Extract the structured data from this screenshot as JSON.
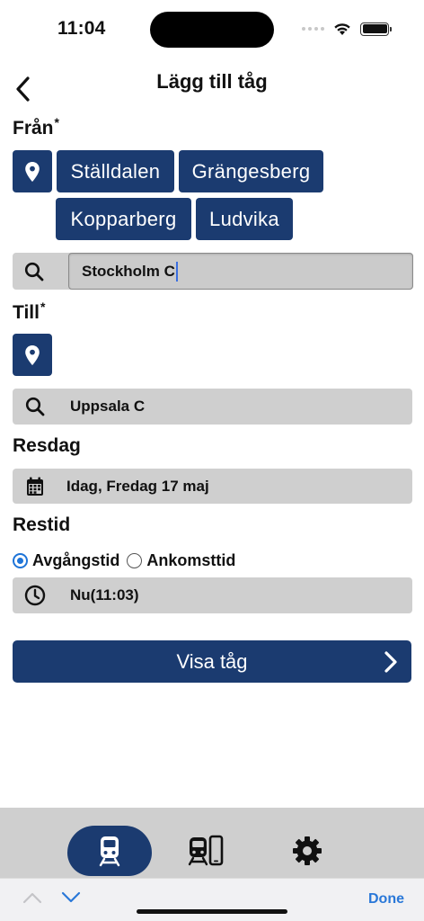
{
  "status_bar": {
    "time": "11:04"
  },
  "header": {
    "title": "Lägg till tåg"
  },
  "from": {
    "label": "Från",
    "required_mark": "*",
    "chips": [
      "Ställdalen",
      "Grängesberg",
      "Kopparberg",
      "Ludvika"
    ],
    "search_value": "Stockholm C"
  },
  "to": {
    "label": "Till",
    "required_mark": "*",
    "search_value": "Uppsala C"
  },
  "travel_day": {
    "label": "Resdag",
    "value": "Idag, Fredag 17 maj"
  },
  "travel_time": {
    "label": "Restid",
    "options": [
      "Avgångstid",
      "Ankomsttid"
    ],
    "selected": "Avgångstid",
    "value": "Nu(11:03)"
  },
  "submit": {
    "label": "Visa tåg"
  },
  "tabbar": {
    "items": [
      "train-icon",
      "train-phone-icon",
      "settings-gear-icon"
    ],
    "active": 0
  },
  "keyboard_accessory": {
    "done_label": "Done"
  },
  "colors": {
    "primary": "#1b3b70",
    "field_bg": "#cfcfcf",
    "accent": "#1e74d8",
    "done": "#2a78d8"
  }
}
